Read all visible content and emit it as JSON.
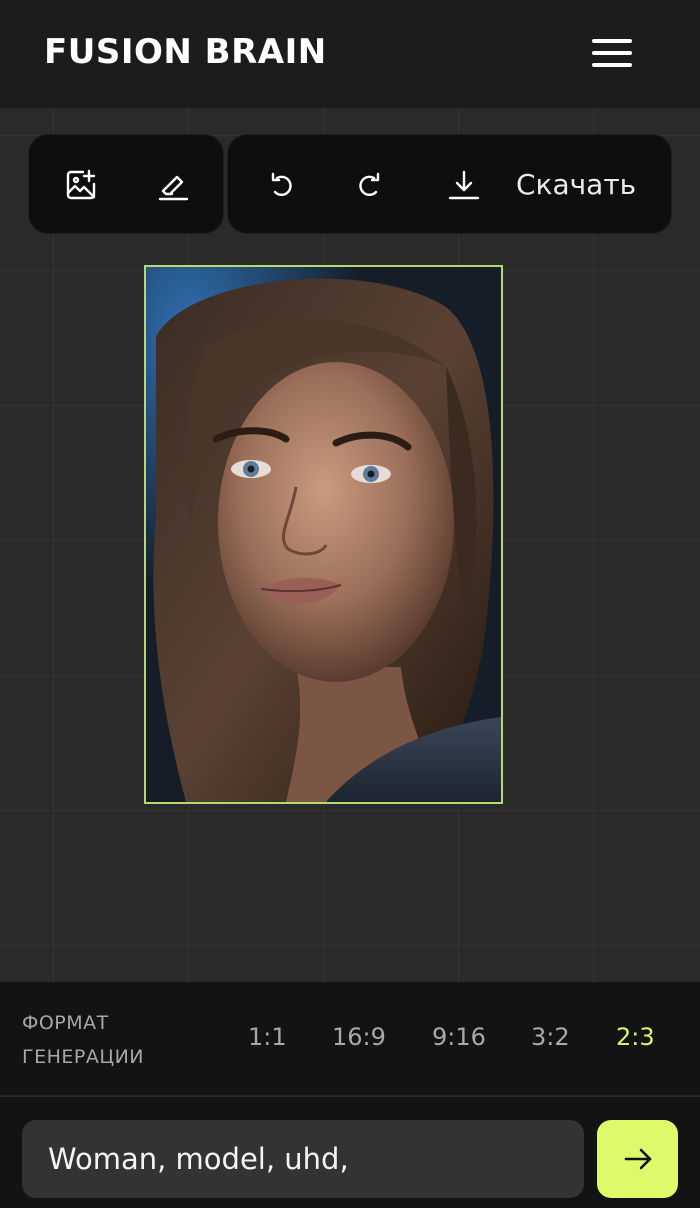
{
  "header": {
    "logo": "FUSION BRAIN",
    "menu_icon": "hamburger-menu-icon"
  },
  "toolbar": {
    "left_icons": [
      "image-add-icon",
      "eraser-icon"
    ],
    "right_icons": [
      "undo-icon",
      "redo-icon",
      "download-icon"
    ],
    "download_label": "Скачать"
  },
  "canvas": {
    "image_subject": "portrait-photo",
    "frame_color": "#b6d96b"
  },
  "format": {
    "label": "ФОРМАТ\nГЕНЕРАЦИИ",
    "ratios": [
      "1:1",
      "16:9",
      "9:16",
      "3:2",
      "2:3"
    ],
    "selected": "2:3",
    "accent_color": "#d6f56b"
  },
  "prompt": {
    "value": "Woman, model, uhd,",
    "send_icon": "arrow-right-icon",
    "send_color": "#dcfa6a"
  }
}
